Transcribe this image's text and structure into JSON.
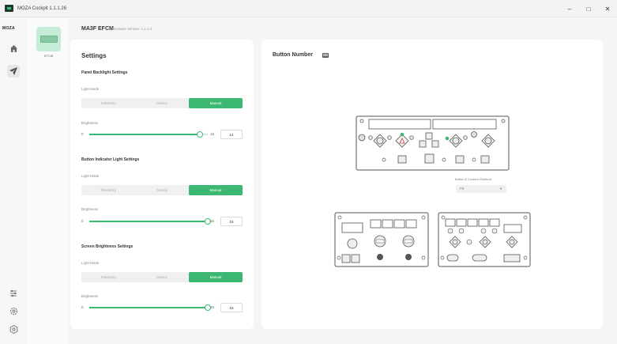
{
  "window": {
    "title": "MOZA Cockpit 1.1.1.26",
    "minimize": "–",
    "maximize": "□",
    "close": "✕"
  },
  "rail": {
    "brand": "MOZA",
    "top_icons": [
      "home-icon",
      "plane-icon"
    ],
    "bottom_icons": [
      "sliders-icon",
      "gear-icon",
      "settings-cog-icon"
    ]
  },
  "device": {
    "card_label": "EFCM",
    "name": "MA3F EFCM",
    "firmware": "Firmware Version: 1.1.1.3"
  },
  "settings": {
    "title": "Settings",
    "sections": [
      {
        "title": "Panel Backlight Settings",
        "light_mode_label": "Light Mode",
        "options": [
          "Telemetry",
          "Device",
          "Manual"
        ],
        "active_index": 2,
        "brightness_label": "Brightness",
        "min": "0",
        "max": "15",
        "value": "14",
        "fraction": 0.933
      },
      {
        "title": "Button Indicator Light Settings",
        "light_mode_label": "Light Mode",
        "options": [
          "Telemetry",
          "Device",
          "Manual"
        ],
        "active_index": 2,
        "brightness_label": "Brightness",
        "min": "0",
        "max": "15",
        "value": "15",
        "fraction": 1.0
      },
      {
        "title": "Screen Brightness Settings",
        "light_mode_label": "Light Mode",
        "options": [
          "Telemetry",
          "Device",
          "Manual"
        ],
        "active_index": 2,
        "brightness_label": "Brightness",
        "min": "0",
        "max": "15",
        "value": "15",
        "fraction": 1.0
      }
    ]
  },
  "button_number": {
    "title": "Button Number",
    "shortcut_label": "Button 5 Custom Shortcut",
    "shortcut_value": "F8",
    "accent": "#3cb872"
  }
}
